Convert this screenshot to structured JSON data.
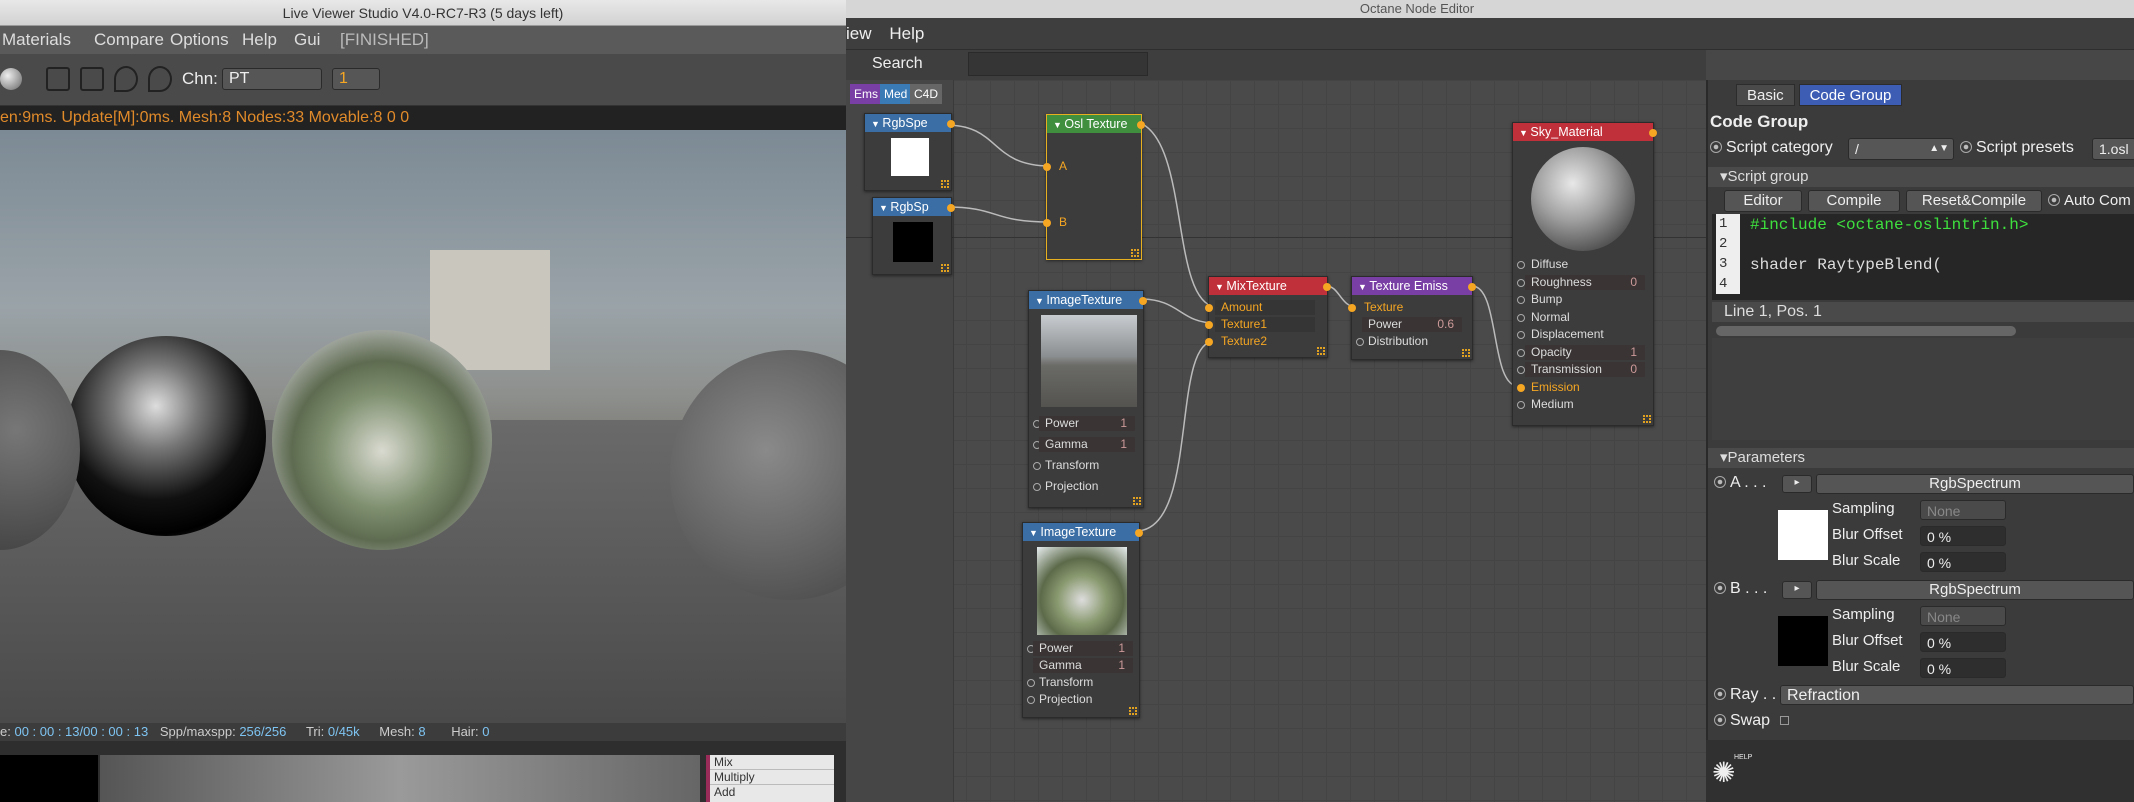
{
  "node_editor": {
    "window_title": "Octane Node Editor",
    "menu": [
      "iew",
      "Help"
    ],
    "search_label": "Search",
    "palette_tabs": [
      "Ems",
      "Med",
      "C4D"
    ],
    "nodes": {
      "rgbspe": {
        "title": "RgbSpe"
      },
      "rgbsp": {
        "title": "RgbSp"
      },
      "osl": {
        "title": "Osl Texture",
        "inputs": [
          "A",
          "B"
        ]
      },
      "image1": {
        "title": "ImageTexture",
        "params": [
          {
            "name": "Power",
            "value": "1"
          },
          {
            "name": "Gamma",
            "value": "1"
          },
          {
            "name": "Transform",
            "value": ""
          },
          {
            "name": "Projection",
            "value": ""
          }
        ]
      },
      "image2": {
        "title": "ImageTexture",
        "params": [
          {
            "name": "Power",
            "value": "1"
          },
          {
            "name": "Gamma",
            "value": "1"
          },
          {
            "name": "Transform",
            "value": ""
          },
          {
            "name": "Projection",
            "value": ""
          }
        ]
      },
      "mix": {
        "title": "MixTexture",
        "inputs": [
          "Amount",
          "Texture1",
          "Texture2"
        ]
      },
      "emiss": {
        "title": "Texture Emiss",
        "params": [
          {
            "name": "Texture",
            "value": ""
          },
          {
            "name": "Power",
            "value": "0.6"
          },
          {
            "name": "Distribution",
            "value": ""
          }
        ]
      },
      "sky": {
        "title": "Sky_Material",
        "params": [
          {
            "name": "Diffuse",
            "value": ""
          },
          {
            "name": "Roughness",
            "value": "0"
          },
          {
            "name": "Bump",
            "value": ""
          },
          {
            "name": "Normal",
            "value": ""
          },
          {
            "name": "Displacement",
            "value": ""
          },
          {
            "name": "Opacity",
            "value": "1"
          },
          {
            "name": "Transmission",
            "value": "0"
          },
          {
            "name": "Emission",
            "value": ""
          },
          {
            "name": "Medium",
            "value": ""
          }
        ]
      }
    }
  },
  "panel": {
    "tabs": [
      "Basic",
      "Code Group"
    ],
    "active_tab": "Code Group",
    "heading": "Code Group",
    "script_category_label": "Script category",
    "script_category_value": "/",
    "script_presets_label": "Script presets",
    "script_presets_value": "1.osl",
    "script_group_label": "Script group",
    "buttons": [
      "Editor",
      "Compile",
      "Reset&Compile"
    ],
    "auto_compile_label": "Auto Com",
    "code_lines": [
      {
        "n": "1",
        "text": "#include <octane-oslintrin.h>"
      },
      {
        "n": "2",
        "text": ""
      },
      {
        "n": "3",
        "text": "shader RaytypeBlend("
      },
      {
        "n": "4",
        "text": ""
      }
    ],
    "cursor_status": "Line 1, Pos. 1",
    "parameters_label": "Parameters",
    "param_a": {
      "label": "A . . .",
      "type": "RgbSpectrum",
      "swatch": "#ffffff",
      "sampling_label": "Sampling",
      "sampling_value": "None",
      "blur_offset_label": "Blur Offset",
      "blur_offset_value": "0 %",
      "blur_scale_label": "Blur Scale",
      "blur_scale_value": "0 %"
    },
    "param_b": {
      "label": "B . . .",
      "type": "RgbSpectrum",
      "swatch": "#000000",
      "sampling_label": "Sampling",
      "sampling_value": "None",
      "blur_offset_label": "Blur Offset",
      "blur_offset_value": "0 %",
      "blur_scale_label": "Blur Scale",
      "blur_scale_value": "0 %"
    },
    "ray_label": "Ray . .",
    "ray_value": "Refraction",
    "swap_label": "Swap",
    "help_label": "HELP"
  },
  "live_viewer": {
    "title": "Live Viewer Studio V4.0-RC7-R3 (5 days left)",
    "menu": [
      "Materials",
      "Compare",
      "Options",
      "Help",
      "Gui",
      "[FINISHED]"
    ],
    "channel_label": "Chn:",
    "channel_value": "PT",
    "channel_index": "1",
    "status_line": "en:9ms. Update[M]:0ms. Mesh:8 Nodes:33 Movable:8  0 0",
    "footer": {
      "time_label": "e:",
      "time_value": "00 : 00 : 13/00 : 00 : 13",
      "spp_label": "Spp/maxspp:",
      "spp_value": "256/256",
      "tri_label": "Tri:",
      "tri_value": "0/45k",
      "mesh_label": "Mesh:",
      "mesh_value": "8",
      "hair_label": "Hair:",
      "hair_value": "0"
    },
    "blend_list": [
      "Mix",
      "Multiply",
      "Add"
    ]
  },
  "colors": {
    "node_blue": "#3a6ea5",
    "node_green": "#3f8f3f",
    "node_red": "#c0303a",
    "node_purple": "#7a3fa5",
    "accent_orange": "#f5a623"
  }
}
